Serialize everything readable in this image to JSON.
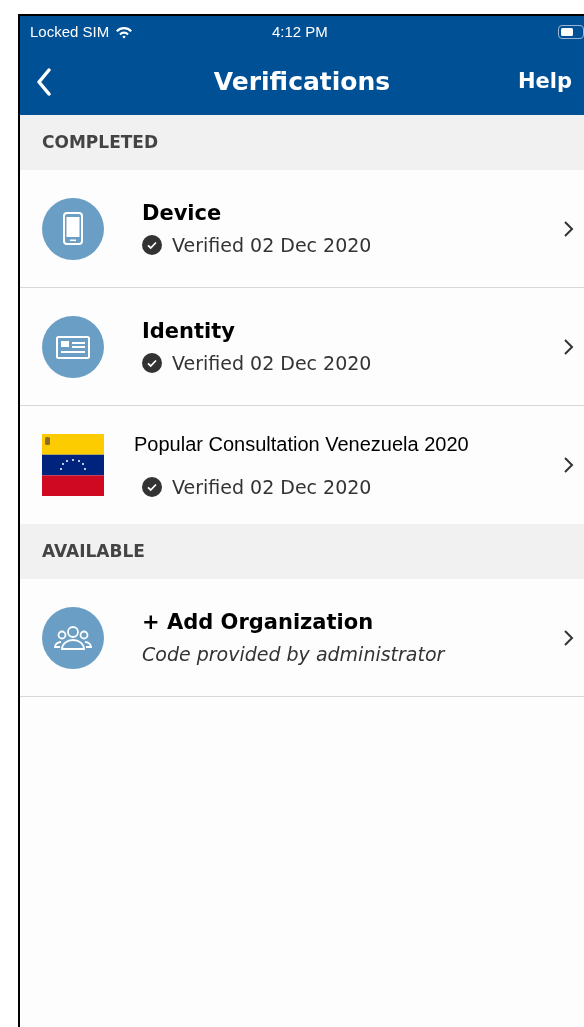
{
  "status_bar": {
    "carrier": "Locked SIM",
    "time": "4:12 PM"
  },
  "nav": {
    "title": "Verifications",
    "action": "Help"
  },
  "sections": [
    {
      "header": "COMPLETED",
      "items": [
        {
          "kind": "device",
          "verified": true,
          "title": "Device",
          "subtitle": "Verified 02 Dec 2020"
        },
        {
          "kind": "identity",
          "verified": true,
          "title": "Identity",
          "subtitle": "Verified 02 Dec 2020"
        },
        {
          "kind": "flag",
          "verified": true,
          "title": "Popular Consultation Venezuela 2020",
          "subtitle": "Verified 02 Dec 2020"
        }
      ]
    },
    {
      "header": "AVAILABLE",
      "items": [
        {
          "kind": "group",
          "verified": false,
          "title": "+ Add Organization",
          "subtitle": "Code provided by administrator"
        }
      ]
    }
  ]
}
